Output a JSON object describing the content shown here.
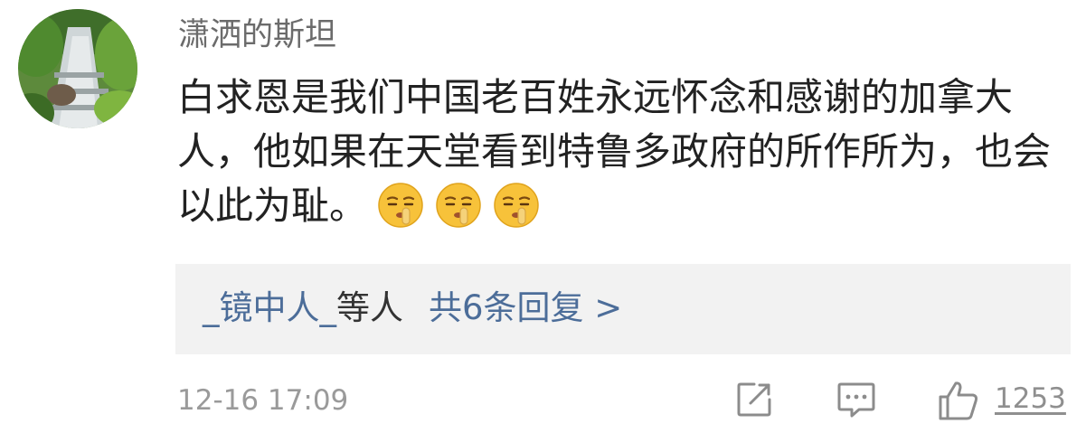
{
  "comment": {
    "username": "潇洒的斯坦",
    "text": "白求恩是我们中国老百姓永远怀念和感谢的加拿大人，他如果在天堂看到特鲁多政府的所作所为，也会以此为耻。",
    "emojis": [
      "shushing-face-emoji",
      "shushing-face-emoji",
      "shushing-face-emoji"
    ]
  },
  "replies": {
    "user": "_镜中人_",
    "suffix": "等人",
    "count_label": "共6条回复 >"
  },
  "footer": {
    "timestamp": "12-16 17:09",
    "like_count": "1253",
    "icons": [
      "share-icon",
      "comment-icon",
      "like-icon"
    ]
  },
  "colors": {
    "username": "#6b6b6b",
    "text": "#222222",
    "link": "#4c6d99",
    "meta": "#9a9a9a",
    "reply_bg": "#f2f2f2"
  }
}
